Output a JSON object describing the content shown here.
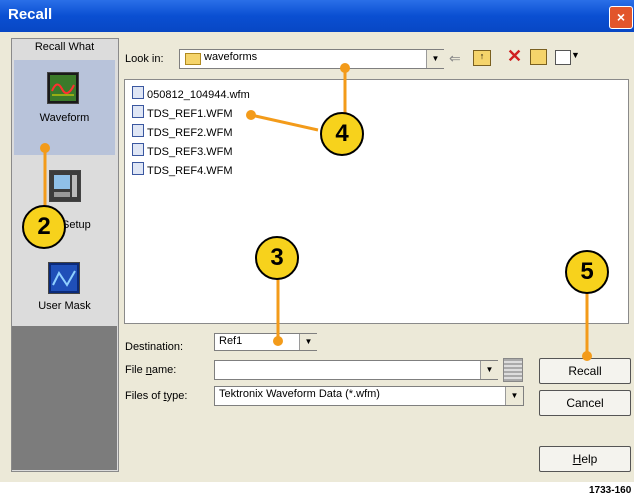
{
  "window": {
    "title": "Recall",
    "close": "×"
  },
  "left_panel": {
    "header": "Recall What",
    "items": [
      {
        "label": "Waveform",
        "selected": true
      },
      {
        "label": "Setup",
        "selected": false
      },
      {
        "label": "User Mask",
        "selected": false
      }
    ]
  },
  "lookin": {
    "label": "Look in:",
    "value": "waveforms"
  },
  "files": [
    "050812_104944.wfm",
    "TDS_REF1.WFM",
    "TDS_REF2.WFM",
    "TDS_REF3.WFM",
    "TDS_REF4.WFM"
  ],
  "destination": {
    "label": "Destination:",
    "value": "Ref1"
  },
  "filename": {
    "label": "File name:",
    "value": ""
  },
  "filetype": {
    "label": "Files of type:",
    "value": "Tektronix Waveform Data (*.wfm)"
  },
  "buttons": {
    "recall": "Recall",
    "cancel": "Cancel",
    "help": "Help"
  },
  "callouts": [
    "2",
    "3",
    "4",
    "5"
  ],
  "figure_id": "1733-160",
  "colors": {
    "callout_fill": "#f7d21c",
    "connector": "#f39b1a"
  }
}
